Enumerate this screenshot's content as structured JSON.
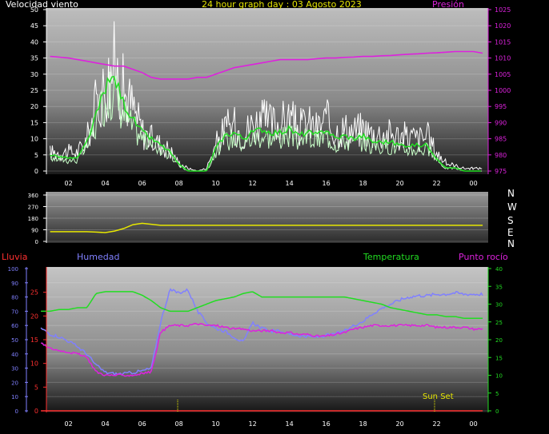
{
  "header": {
    "wind_label": "Velocidad viento",
    "title": "24 hour graph day : 03 Agosto 2023",
    "pressure_label": "Presión"
  },
  "compass": [
    "N",
    "W",
    "S",
    "E",
    "N"
  ],
  "bottom_labels": {
    "rain": "Lluvia",
    "humidity": "Humedad",
    "temperature": "Temperatura",
    "dewpoint": "Punto rocío",
    "sunset": "Sun Set"
  },
  "colors": {
    "wind_gust": "#ffffff",
    "wind_avg_raw": "#c8ffc8",
    "wind_avg_smooth": "#22dd22",
    "pressure": "#dd22dd",
    "direction": "#e6e600",
    "rain": "#ff3030",
    "humidity": "#8080ff",
    "temperature": "#22dd22",
    "dewpoint": "#dd22dd",
    "sunset": "#e6e600"
  },
  "chart_data": [
    {
      "type": "line",
      "title": "24 hour graph day : 03 Agosto 2023",
      "xticks": [
        "02",
        "04",
        "06",
        "08",
        "10",
        "12",
        "14",
        "16",
        "18",
        "20",
        "22",
        "00"
      ],
      "left_axis": {
        "label": "Velocidad viento",
        "ylim": [
          0,
          50
        ],
        "ticks": [
          0,
          5,
          10,
          15,
          20,
          25,
          30,
          35,
          40,
          45,
          50
        ]
      },
      "right_axis": {
        "label": "Presión",
        "ylim": [
          975,
          1025
        ],
        "ticks": [
          975,
          980,
          985,
          990,
          995,
          1000,
          1005,
          1010,
          1015,
          1020,
          1025
        ]
      },
      "x_hours": [
        1,
        2,
        2.5,
        3,
        3.5,
        4,
        4.5,
        5,
        5.5,
        6,
        6.5,
        7,
        7.5,
        8,
        8.5,
        9,
        9.5,
        10,
        10.5,
        11,
        11.5,
        12,
        12.5,
        13,
        13.5,
        14,
        14.5,
        15,
        15.5,
        16,
        16.5,
        17,
        17.5,
        18,
        18.5,
        19,
        19.5,
        20,
        20.5,
        21,
        21.5,
        22,
        22.5,
        23,
        23.5,
        24,
        24.5
      ],
      "series": [
        {
          "values": [
            7,
            7,
            7,
            12,
            25,
            32,
            40,
            30,
            24,
            15,
            12,
            10,
            8,
            3,
            1,
            0,
            1,
            10,
            16,
            17,
            14,
            18,
            19,
            18,
            18,
            20,
            16,
            18,
            16,
            19,
            15,
            16,
            15,
            16,
            14,
            14,
            14,
            13,
            13,
            12,
            13,
            7,
            3,
            2,
            1,
            1,
            1
          ]
        },
        {
          "values": [
            5,
            4,
            4,
            9,
            17,
            26,
            29,
            21,
            16,
            12,
            10,
            8,
            6,
            2,
            0,
            0,
            0,
            7,
            11,
            12,
            10,
            12,
            13,
            12,
            12,
            13,
            11,
            12,
            11,
            13,
            10,
            11,
            10,
            11,
            9,
            9,
            9,
            8,
            8,
            8,
            8,
            4,
            1,
            1,
            0,
            0,
            0
          ]
        },
        {
          "values": [
            1010.5,
            1010,
            1009.5,
            1009,
            1008.5,
            1008,
            1007.5,
            1007.5,
            1006.5,
            1005.5,
            1004,
            1003.5,
            1003.5,
            1003.5,
            1003.5,
            1004,
            1004,
            1005,
            1006,
            1007,
            1007.5,
            1008,
            1008.5,
            1009,
            1009.5,
            1009.5,
            1009.5,
            1009.5,
            1009.8,
            1010,
            1010,
            1010.2,
            1010.3,
            1010.5,
            1010.5,
            1010.7,
            1010.8,
            1011,
            1011.2,
            1011.3,
            1011.5,
            1011.6,
            1011.8,
            1012,
            1012,
            1012,
            1011.5
          ]
        }
      ]
    },
    {
      "type": "line",
      "ylim": [
        0,
        360
      ],
      "yticks": [
        0,
        90,
        180,
        270,
        360
      ],
      "x_hours": [
        1,
        2,
        3,
        3.5,
        4,
        4.5,
        5,
        5.5,
        6,
        7,
        8,
        10,
        12,
        14,
        16,
        18,
        20,
        22,
        24,
        24.5
      ],
      "values": [
        75,
        75,
        75,
        72,
        68,
        80,
        100,
        130,
        140,
        125,
        125,
        125,
        125,
        125,
        125,
        125,
        125,
        125,
        125,
        125
      ]
    },
    {
      "type": "line",
      "xticks": [
        "02",
        "04",
        "06",
        "08",
        "10",
        "12",
        "14",
        "16",
        "18",
        "20",
        "22",
        "00"
      ],
      "rain_axis": {
        "label": "Lluvia",
        "ylim": [
          0,
          30
        ],
        "ticks": [
          0,
          5,
          10,
          15,
          20,
          25
        ]
      },
      "humidity_axis": {
        "label": "Humedad",
        "ylim": [
          0,
          100
        ],
        "ticks": [
          0,
          10,
          20,
          30,
          40,
          50,
          60,
          70,
          80,
          90,
          100
        ]
      },
      "temperature_axis": {
        "label": "Temperatura",
        "ylim": [
          0,
          40
        ],
        "ticks": [
          0,
          5,
          10,
          15,
          20,
          25,
          30,
          35,
          40
        ]
      },
      "x_hours": [
        0.5,
        1,
        1.5,
        2,
        2.5,
        3,
        3.5,
        4,
        4.5,
        5,
        5.5,
        6,
        6.5,
        7,
        7.5,
        8,
        8.5,
        9,
        9.5,
        10,
        10.5,
        11,
        11.5,
        12,
        12.5,
        13,
        13.5,
        14,
        14.5,
        15,
        15.5,
        16,
        16.5,
        17,
        17.5,
        18,
        18.5,
        19,
        19.5,
        20,
        20.5,
        21,
        21.5,
        22,
        22.5,
        23,
        23.5,
        24,
        24.5
      ],
      "series": [
        {
          "name": "Lluvia",
          "values": [
            0,
            0,
            0,
            0,
            0,
            0,
            0,
            0,
            0,
            0,
            0,
            0,
            0,
            0,
            0,
            0,
            0,
            0,
            0,
            0,
            0,
            0,
            0,
            0,
            0,
            0,
            0,
            0,
            0,
            0,
            0,
            0,
            0,
            0,
            0,
            0,
            0,
            0,
            0,
            0,
            0,
            0,
            0,
            0,
            0,
            0,
            0,
            0,
            0
          ]
        },
        {
          "name": "Humedad",
          "values": [
            58,
            54,
            52,
            49,
            45,
            40,
            32,
            27,
            26,
            26,
            27,
            28,
            30,
            62,
            85,
            83,
            85,
            70,
            62,
            58,
            56,
            52,
            48,
            62,
            58,
            56,
            56,
            54,
            53,
            52,
            52,
            53,
            54,
            56,
            60,
            63,
            68,
            72,
            75,
            78,
            80,
            81,
            81,
            82,
            82,
            83,
            82,
            82,
            82
          ]
        },
        {
          "name": "Temperatura",
          "values": [
            28,
            28,
            28.5,
            28.5,
            29,
            29,
            33,
            33.5,
            33.5,
            33.5,
            33.5,
            32.5,
            31,
            29,
            28,
            28,
            28,
            29,
            30,
            31,
            31.5,
            32,
            33,
            33.5,
            32,
            32,
            32,
            32,
            32,
            32,
            32,
            32,
            32,
            32,
            31.5,
            31,
            30.5,
            30,
            29,
            28.5,
            28,
            27.5,
            27,
            27,
            26.5,
            26.5,
            26,
            26,
            26
          ]
        },
        {
          "name": "Punto rocío",
          "values": [
            19,
            17.5,
            17,
            16.5,
            16,
            15,
            11,
            10,
            10,
            10,
            10,
            10.5,
            11,
            22,
            24,
            24,
            24,
            24.5,
            24,
            24,
            23.5,
            23,
            23,
            22.5,
            22.5,
            22.5,
            22,
            22,
            21.5,
            21.5,
            21,
            21,
            21.5,
            22,
            23,
            23.5,
            24,
            24,
            24,
            24,
            24,
            24,
            24,
            23.5,
            23.5,
            23.5,
            23.5,
            23,
            23
          ]
        }
      ]
    }
  ]
}
